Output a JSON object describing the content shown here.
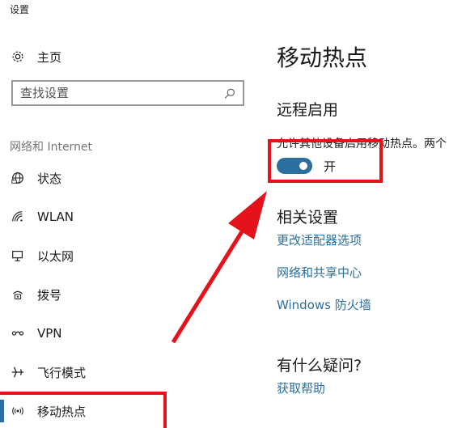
{
  "window": {
    "title": "设置"
  },
  "sidebar": {
    "home_label": "主页",
    "search_placeholder": "查找设置",
    "section_label": "网络和 Internet",
    "items": [
      {
        "label": "状态",
        "icon": "globe-status-icon"
      },
      {
        "label": "WLAN",
        "icon": "wifi-icon"
      },
      {
        "label": "以太网",
        "icon": "ethernet-icon"
      },
      {
        "label": "拨号",
        "icon": "dialup-icon"
      },
      {
        "label": "VPN",
        "icon": "vpn-icon"
      },
      {
        "label": "飞行模式",
        "icon": "airplane-icon"
      },
      {
        "label": "移动热点",
        "icon": "mobile-hotspot-icon",
        "selected": true
      }
    ]
  },
  "main": {
    "title": "移动热点",
    "remote_section": {
      "heading": "远程启用",
      "description": "允许其他设备启用移动热点。两个",
      "toggle_state": "开",
      "toggle_on": true
    },
    "related_section": {
      "heading": "相关设置",
      "links": [
        "更改适配器选项",
        "网络和共享中心",
        "Windows 防火墙"
      ]
    },
    "help_section": {
      "heading": "有什么疑问?",
      "link": "获取帮助"
    }
  },
  "colors": {
    "accent": "#2b6f9e",
    "annotation": "#e3121b"
  }
}
